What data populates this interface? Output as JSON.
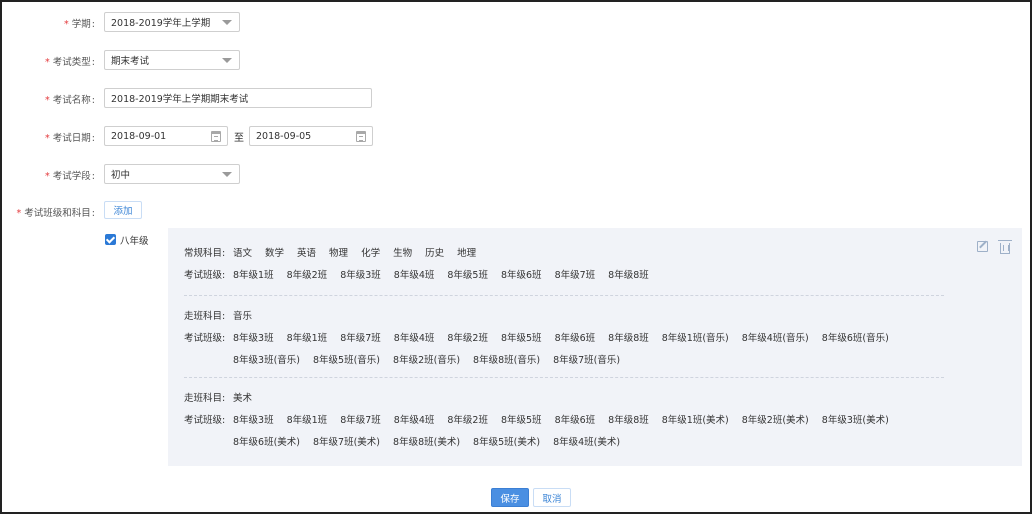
{
  "form": {
    "term": {
      "label": "学期",
      "value": "2018-2019学年上学期"
    },
    "exam_type": {
      "label": "考试类型",
      "value": "期末考试"
    },
    "exam_name": {
      "label": "考试名称",
      "value": "2018-2019学年上学期期末考试"
    },
    "exam_date": {
      "label": "考试日期",
      "start": "2018-09-01",
      "separator": "至",
      "end": "2018-09-05"
    },
    "exam_stage": {
      "label": "考试学段",
      "value": "初中"
    },
    "classes_subjects": {
      "label": "考试班级和科目",
      "add_label": "添加"
    },
    "required_mark": "*"
  },
  "grade": {
    "label": "八年级",
    "checked": true,
    "groups": [
      {
        "subject_key": "常规科目:",
        "subjects": [
          "语文",
          "数学",
          "英语",
          "物理",
          "化学",
          "生物",
          "历史",
          "地理"
        ],
        "class_key": "考试班级:",
        "class_lines": [
          [
            "8年级1班",
            "8年级2班",
            "8年级3班",
            "8年级4班",
            "8年级5班",
            "8年级6班",
            "8年级7班",
            "8年级8班"
          ]
        ]
      },
      {
        "subject_key": "走班科目:",
        "subjects": [
          "音乐"
        ],
        "class_key": "考试班级:",
        "class_lines": [
          [
            "8年级3班",
            "8年级1班",
            "8年级7班",
            "8年级4班",
            "8年级2班",
            "8年级5班",
            "8年级6班",
            "8年级8班",
            "8年级1班(音乐)",
            "8年级4班(音乐)",
            "8年级6班(音乐)"
          ],
          [
            "8年级3班(音乐)",
            "8年级5班(音乐)",
            "8年级2班(音乐)",
            "8年级8班(音乐)",
            "8年级7班(音乐)"
          ]
        ]
      },
      {
        "subject_key": "走班科目:",
        "subjects": [
          "美术"
        ],
        "class_key": "考试班级:",
        "class_lines": [
          [
            "8年级3班",
            "8年级1班",
            "8年级7班",
            "8年级4班",
            "8年级2班",
            "8年级5班",
            "8年级6班",
            "8年级8班",
            "8年级1班(美术)",
            "8年级2班(美术)",
            "8年级3班(美术)"
          ],
          [
            "8年级6班(美术)",
            "8年级7班(美术)",
            "8年级8班(美术)",
            "8年级5班(美术)",
            "8年级4班(美术)"
          ]
        ]
      }
    ]
  },
  "actions": {
    "save_label": "保存",
    "cancel_label": "取消"
  },
  "icons": {
    "edit": "edit-icon",
    "delete": "trash-icon",
    "calendar": "calendar-icon",
    "dropdown": "chevron-down-icon",
    "check": "checkbox-checked"
  },
  "colors": {
    "required": "#e4393c",
    "primary": "#4a8fe2",
    "link": "#3c85d6",
    "panel_bg": "#f1f3f8"
  }
}
